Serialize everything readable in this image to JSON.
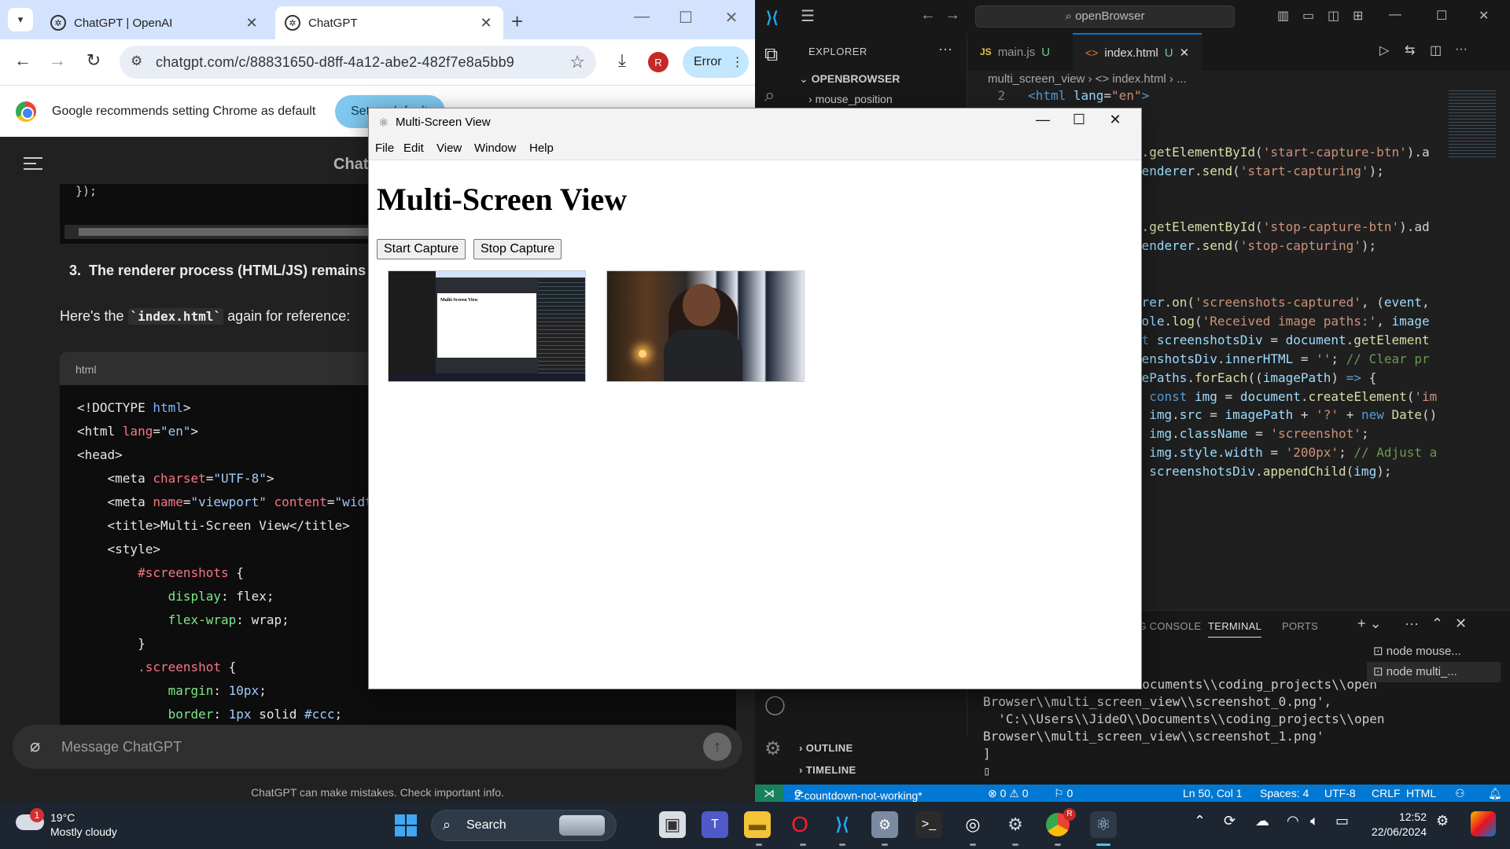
{
  "chrome": {
    "tabs": [
      {
        "label": "ChatGPT | OpenAI",
        "close": "✕"
      },
      {
        "label": "ChatGPT",
        "close": "✕"
      }
    ],
    "new_tab": "+",
    "window_controls": {
      "minimize": "—",
      "maximize": "☐",
      "close": "✕"
    },
    "url": "chatgpt.com/c/88831650-d8ff-4a12-abe2-482f7e8a5bb9",
    "profile_initial": "R",
    "error_label": "Error",
    "infobar": {
      "message": "Google recommends setting Chrome as default",
      "button": "Set as default"
    },
    "page": {
      "title": "ChatGPT",
      "top_code": "});",
      "step_number": "3.",
      "step_text": "The renderer process (HTML/JS) remains",
      "reference_prefix": "Here's the",
      "reference_code": "`index.html`",
      "reference_suffix": "again for reference:",
      "code_lang": "html",
      "composer_placeholder": "Message ChatGPT",
      "disclaimer": "ChatGPT can make mistakes. Check important info."
    }
  },
  "vscode": {
    "search": "openBrowser",
    "explorer_title": "EXPLORER",
    "explorer_more": "···",
    "project": "OPENBROWSER",
    "tree_item": "mouse_position",
    "tabs": [
      {
        "icon": "JS",
        "label": "main.js",
        "status": "U"
      },
      {
        "icon": "<>",
        "label": "index.html",
        "status": "U"
      }
    ],
    "breadcrumb": "multi_screen_view  ›  <> index.html  ›  ...",
    "panel_tabs": [
      "DEBUG CONSOLE",
      "TERMINAL",
      "PORTS"
    ],
    "terminals": [
      "node mouse...",
      "node multi_..."
    ],
    "outline": "OUTLINE",
    "timeline": "TIMELINE",
    "status": {
      "branch": "2-countdown-not-working*",
      "errors": "⊗ 0 ⚠ 0",
      "ports": "⚐ 0",
      "position": "Ln 50, Col 1",
      "spaces": "Spaces: 4",
      "encoding": "UTF-8",
      "eol": "CRLF",
      "language": "HTML"
    }
  },
  "app_window": {
    "title": "Multi-Screen View",
    "menu": [
      "File",
      "Edit",
      "View",
      "Window",
      "Help"
    ],
    "heading": "Multi-Screen View",
    "start_button": "Start Capture",
    "stop_button": "Stop Capture",
    "thumb_title": "Multi-Screen View"
  },
  "taskbar": {
    "weather_badge": "1",
    "temperature": "19°C",
    "condition": "Mostly cloudy",
    "search": "Search",
    "time": "12:52",
    "date": "22/06/2024",
    "chrome_badge": "R"
  }
}
